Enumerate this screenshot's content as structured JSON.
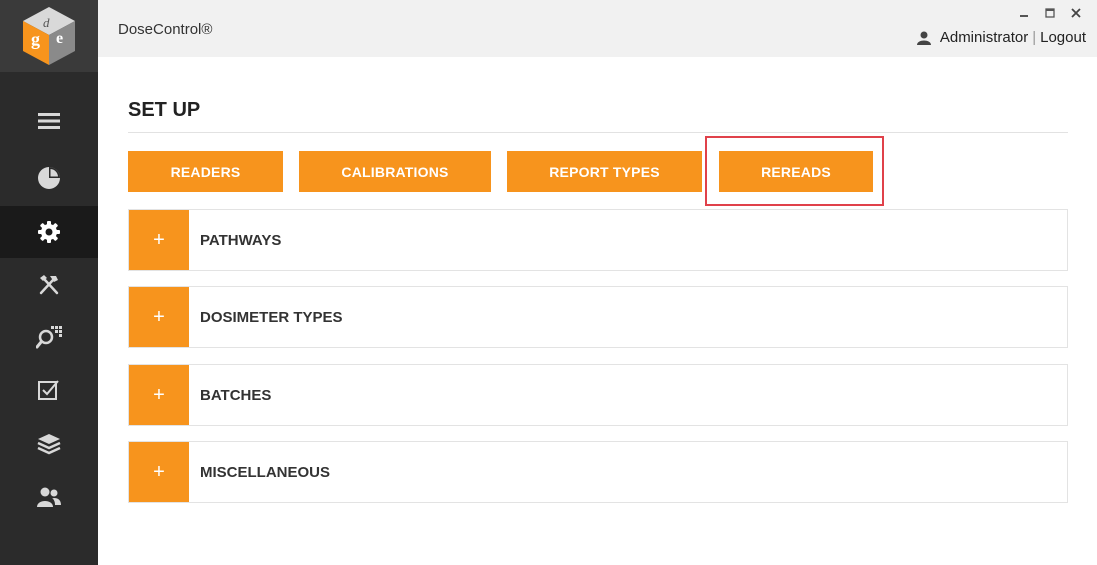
{
  "app": {
    "title": "DoseControl®",
    "logo_icon": "gde-cube-logo"
  },
  "window_controls": {
    "minimize": "‒",
    "maximize": "☐",
    "close": "✕"
  },
  "user": {
    "icon": "user-icon",
    "name": "Administrator",
    "separator": "|",
    "logout_label": "Logout"
  },
  "sidebar": {
    "items": [
      {
        "icon": "menu-icon",
        "active": false
      },
      {
        "icon": "dashboard-pie-icon",
        "active": false
      },
      {
        "icon": "gear-icon",
        "active": true
      },
      {
        "icon": "tools-icon",
        "active": false
      },
      {
        "icon": "dosimeter-search-icon",
        "active": false
      },
      {
        "icon": "checkbox-icon",
        "active": false
      },
      {
        "icon": "layers-icon",
        "active": false
      },
      {
        "icon": "users-icon",
        "active": false
      }
    ]
  },
  "page": {
    "title": "SET UP",
    "tabs": [
      {
        "label": "READERS"
      },
      {
        "label": "CALIBRATIONS"
      },
      {
        "label": "REPORT TYPES"
      },
      {
        "label": "REREADS",
        "highlighted": true
      }
    ],
    "sections": [
      {
        "plus": "+",
        "label": "PATHWAYS"
      },
      {
        "plus": "+",
        "label": "DOSIMETER TYPES"
      },
      {
        "plus": "+",
        "label": "BATCHES"
      },
      {
        "plus": "+",
        "label": "MISCELLANEOUS"
      }
    ]
  },
  "colors": {
    "accent": "#f7941d",
    "sidebar": "#2b2b2b",
    "highlight": "#e0414a"
  }
}
